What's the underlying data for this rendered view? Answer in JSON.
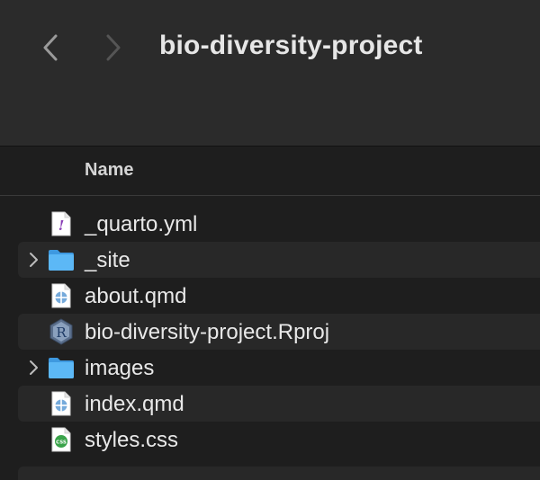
{
  "toolbar": {
    "title": "bio-diversity-project",
    "back_icon": "chevron-left-icon",
    "forward_icon": "chevron-right-icon"
  },
  "columns": {
    "name": "Name"
  },
  "files": [
    {
      "name": "_quarto.yml",
      "kind": "yaml-file",
      "icon": "yaml-file-icon",
      "expandable": false
    },
    {
      "name": "_site",
      "kind": "folder",
      "icon": "folder-icon",
      "expandable": true
    },
    {
      "name": "about.qmd",
      "kind": "quarto-file",
      "icon": "quarto-file-icon",
      "expandable": false
    },
    {
      "name": "bio-diversity-project.Rproj",
      "kind": "rproj-file",
      "icon": "rproj-file-icon",
      "expandable": false
    },
    {
      "name": "images",
      "kind": "folder",
      "icon": "folder-icon",
      "expandable": true
    },
    {
      "name": "index.qmd",
      "kind": "quarto-file",
      "icon": "quarto-file-icon",
      "expandable": false
    },
    {
      "name": "styles.css",
      "kind": "css-file",
      "icon": "css-file-icon",
      "expandable": false
    }
  ],
  "colors": {
    "window_bg": "#1e1e1e",
    "toolbar_bg": "#2b2b2b",
    "row_alt_bg": "#282828",
    "text": "#e8e8e8",
    "folder_blue": "#59b4f5",
    "css_green": "#3aa34a"
  }
}
